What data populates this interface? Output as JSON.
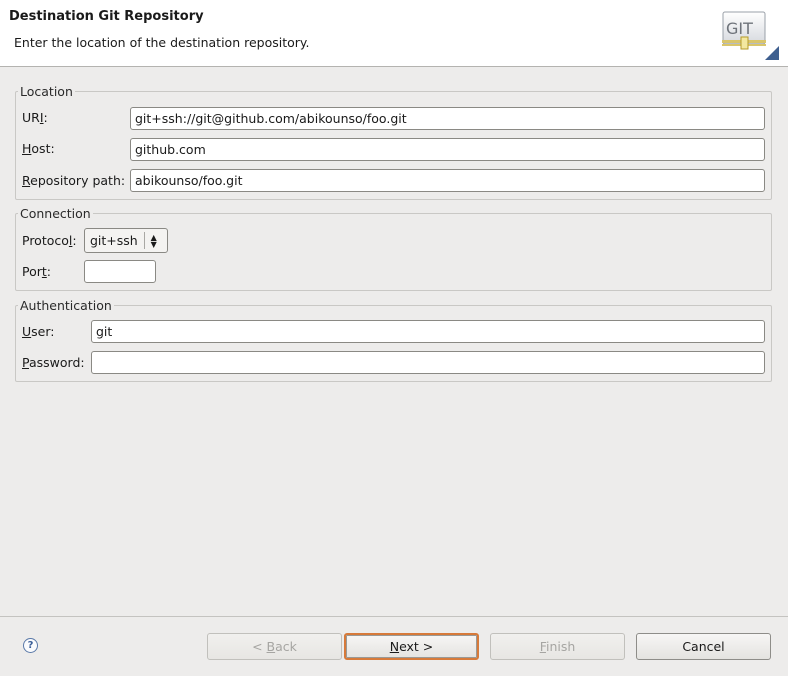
{
  "header": {
    "title": "Destination Git Repository",
    "description": "Enter the location of the destination repository.",
    "logo_text": "GIT"
  },
  "location": {
    "legend": "Location",
    "uri": {
      "label_pre": "UR",
      "label_key": "I",
      "label_post": ":",
      "value": "git+ssh://git@github.com/abikounso/foo.git"
    },
    "host": {
      "label_key": "H",
      "label_post": "ost:",
      "value": "github.com"
    },
    "repo_path": {
      "label_key": "R",
      "label_post": "epository path:",
      "value": "abikounso/foo.git"
    }
  },
  "connection": {
    "legend": "Connection",
    "protocol": {
      "label_pre": "Protoco",
      "label_key": "l",
      "label_post": ":",
      "value": "git+ssh"
    },
    "port": {
      "label_pre": "Por",
      "label_key": "t",
      "label_post": ":",
      "value": ""
    }
  },
  "authentication": {
    "legend": "Authentication",
    "user": {
      "label_key": "U",
      "label_post": "ser:",
      "value": "git"
    },
    "password": {
      "label_key": "P",
      "label_post": "assword:",
      "value": ""
    }
  },
  "footer": {
    "help": "?",
    "back": {
      "pre": "< ",
      "key": "B",
      "post": "ack",
      "enabled": false
    },
    "next": {
      "key": "N",
      "post": "ext >",
      "enabled": true
    },
    "finish": {
      "key": "F",
      "post": "inish",
      "enabled": false
    },
    "cancel": "Cancel"
  }
}
